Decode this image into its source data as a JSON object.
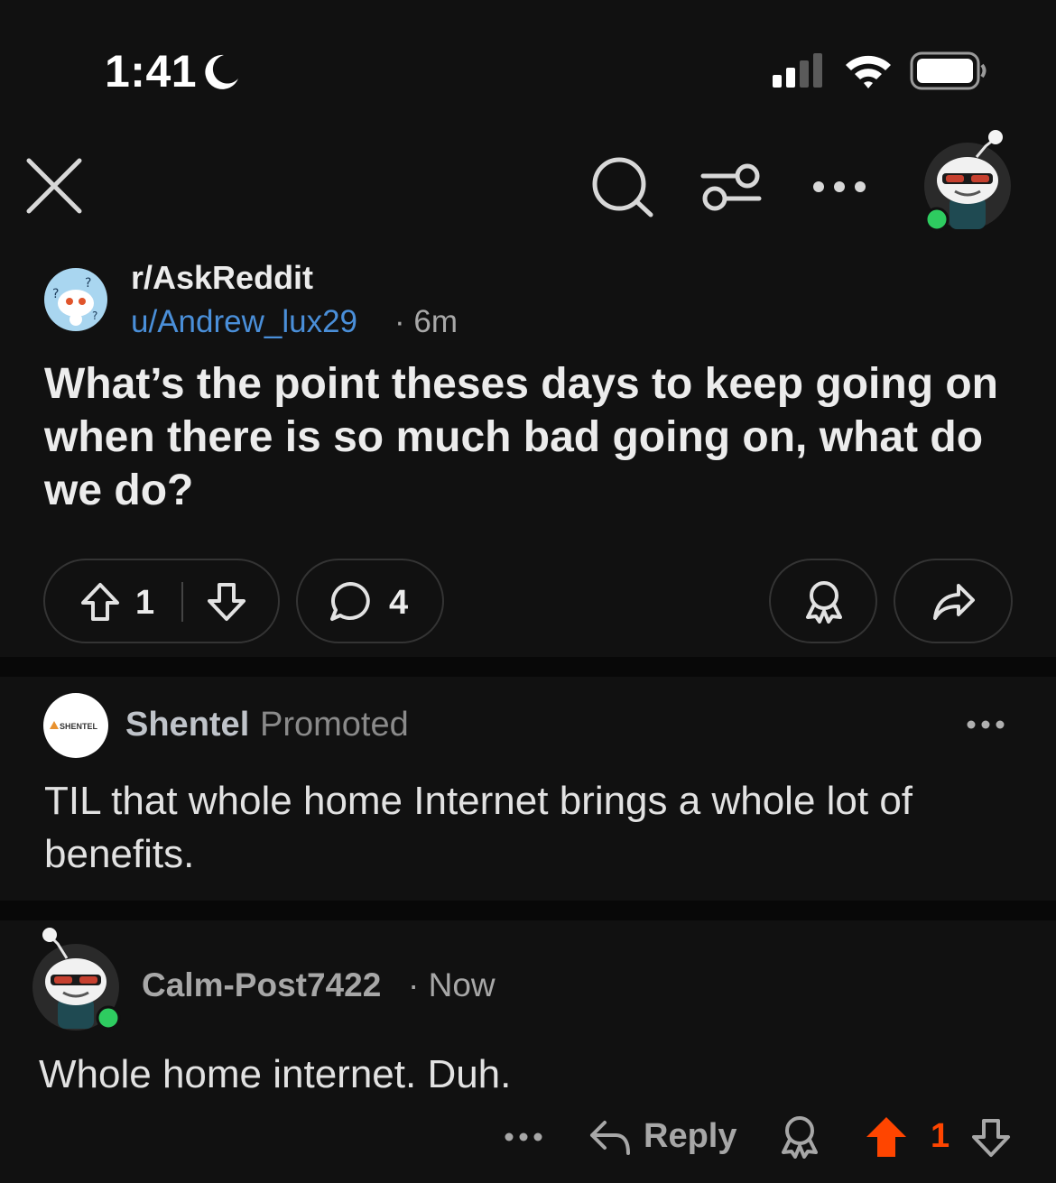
{
  "status_bar": {
    "time": "1:41"
  },
  "post": {
    "subreddit": "r/AskReddit",
    "author": "u/Andrew_lux29",
    "age": "6m",
    "title": "What’s the point theses days to keep going on when there is so much bad going on, what do we do?",
    "votes": "1",
    "comments": "4"
  },
  "promoted": {
    "advertiser": "Shentel",
    "tag": "Promoted",
    "logo_text": "SHENTEL",
    "text": "TIL that whole home Internet brings a whole lot of benefits."
  },
  "comment": {
    "author": "Calm-Post7422",
    "age": "Now",
    "text": "Whole home internet. Duh.",
    "reply_label": "Reply",
    "score": "1"
  },
  "colors": {
    "background": "#111111",
    "link_blue": "#4a8fd9",
    "upvote_orange": "#ff4500",
    "online_green": "#2ecc60"
  }
}
